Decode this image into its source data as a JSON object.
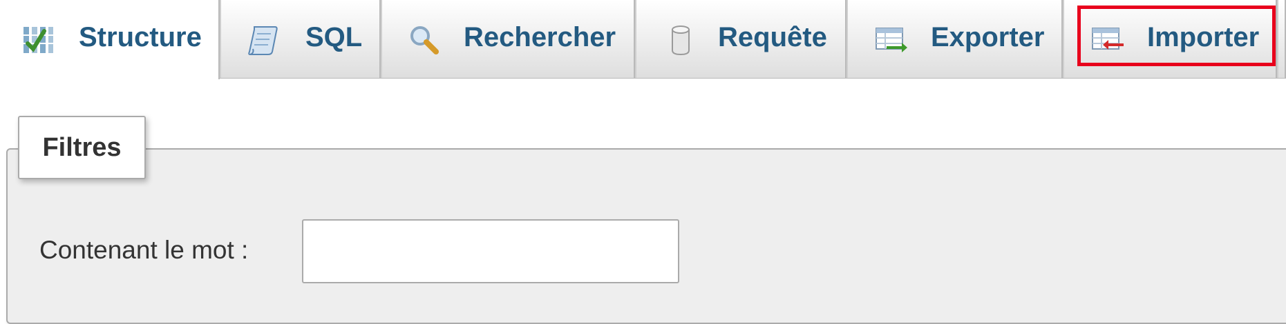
{
  "tabs": {
    "structure": {
      "label": "Structure",
      "icon": "structure-icon"
    },
    "sql": {
      "label": "SQL",
      "icon": "sql-scroll-icon"
    },
    "rechercher": {
      "label": "Rechercher",
      "icon": "magnifier-icon"
    },
    "requete": {
      "label": "Requête",
      "icon": "database-cylinder-icon"
    },
    "exporter": {
      "label": "Exporter",
      "icon": "export-icon"
    },
    "importer": {
      "label": "Importer",
      "icon": "import-icon"
    }
  },
  "active_tab": "structure",
  "highlighted_tab": "importer",
  "colors": {
    "tab_text": "#235a81",
    "highlight": "#e8001c",
    "panel_background": "#eeeeee"
  },
  "filters": {
    "legend": "Filtres",
    "label": "Contenant le mot :",
    "input_value": "",
    "input_placeholder": ""
  }
}
